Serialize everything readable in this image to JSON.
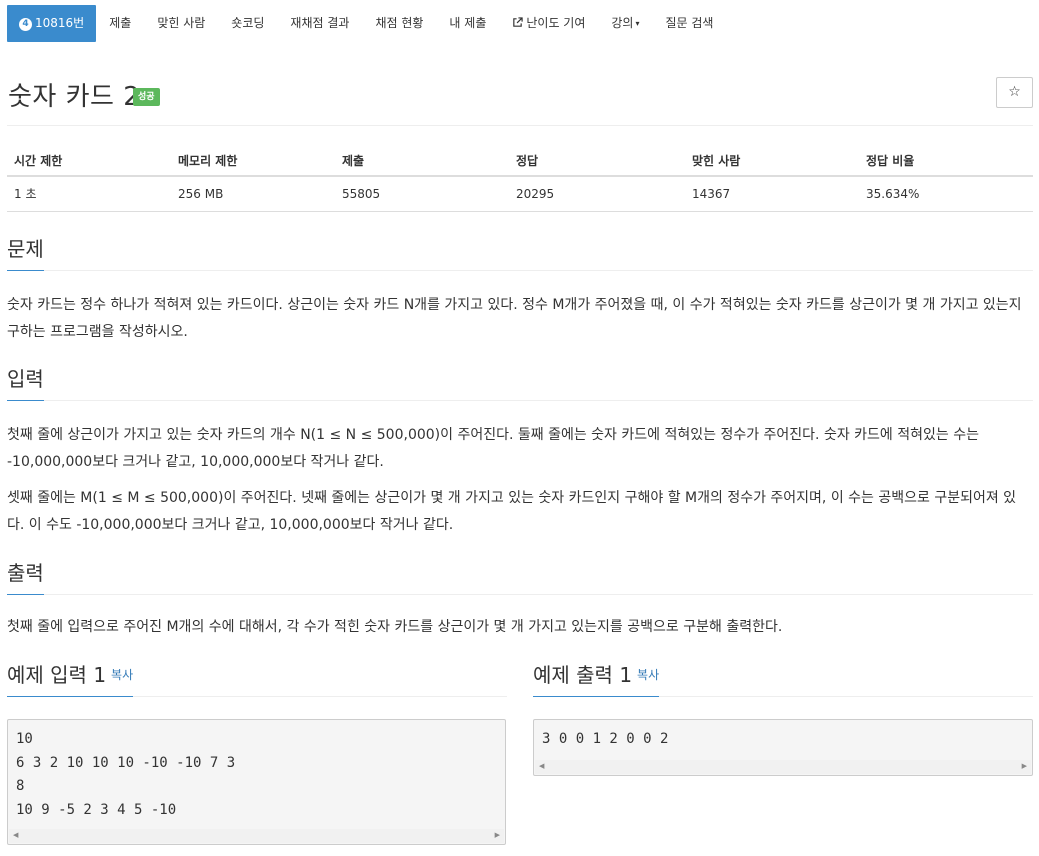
{
  "tabs": [
    {
      "badge": "4",
      "label": "10816번",
      "active": true
    },
    {
      "label": "제출"
    },
    {
      "label": "맞힌 사람"
    },
    {
      "label": "숏코딩"
    },
    {
      "label": "재채점 결과"
    },
    {
      "label": "채점 현황"
    },
    {
      "label": "내 제출"
    },
    {
      "label": "난이도 기여",
      "icon": "external-link-icon"
    },
    {
      "label": "강의",
      "caret": "▾"
    },
    {
      "label": "질문 검색"
    }
  ],
  "problem": {
    "title": "숫자 카드 2",
    "status": "성공",
    "status_color": "#5cb85c",
    "star_glyph": "☆"
  },
  "info": {
    "headers": [
      "시간 제한",
      "메모리 제한",
      "제출",
      "정답",
      "맞힌 사람",
      "정답 비율"
    ],
    "values": [
      "1 초",
      "256 MB",
      "55805",
      "20295",
      "14367",
      "35.634%"
    ]
  },
  "sections": {
    "problem_head": "문제",
    "problem_body": "숫자 카드는 정수 하나가 적혀져 있는 카드이다. 상근이는 숫자 카드 N개를 가지고 있다. 정수 M개가 주어졌을 때, 이 수가 적혀있는 숫자 카드를 상근이가 몇 개 가지고 있는지 구하는 프로그램을 작성하시오.",
    "input_head": "입력",
    "input_body_1": "첫째 줄에 상근이가 가지고 있는 숫자 카드의 개수 N(1 ≤ N ≤ 500,000)이 주어진다. 둘째 줄에는 숫자 카드에 적혀있는 정수가 주어진다. 숫자 카드에 적혀있는 수는 -10,000,000보다 크거나 같고, 10,000,000보다 작거나 같다.",
    "input_body_2": "셋째 줄에는 M(1 ≤ M ≤ 500,000)이 주어진다. 넷째 줄에는 상근이가 몇 개 가지고 있는 숫자 카드인지 구해야 할 M개의 정수가 주어지며, 이 수는 공백으로 구분되어져 있다. 이 수도 -10,000,000보다 크거나 같고, 10,000,000보다 작거나 같다.",
    "output_head": "출력",
    "output_body": "첫째 줄에 입력으로 주어진 M개의 수에 대해서, 각 수가 적힌 숫자 카드를 상근이가 몇 개 가지고 있는지를 공백으로 구분해 출력한다."
  },
  "samples": {
    "input_head": "예제 입력 1",
    "output_head": "예제 출력 1",
    "copy_label": "복사",
    "input_text": "10\n6 3 2 10 10 10 -10 -10 7 3\n8\n10 9 -5 2 3 4 5 -10",
    "output_text": "3 0 0 1 2 0 0 2"
  },
  "colors": {
    "accent": "#3a8bcd",
    "success": "#5cb85c",
    "link": "#337ab7"
  }
}
